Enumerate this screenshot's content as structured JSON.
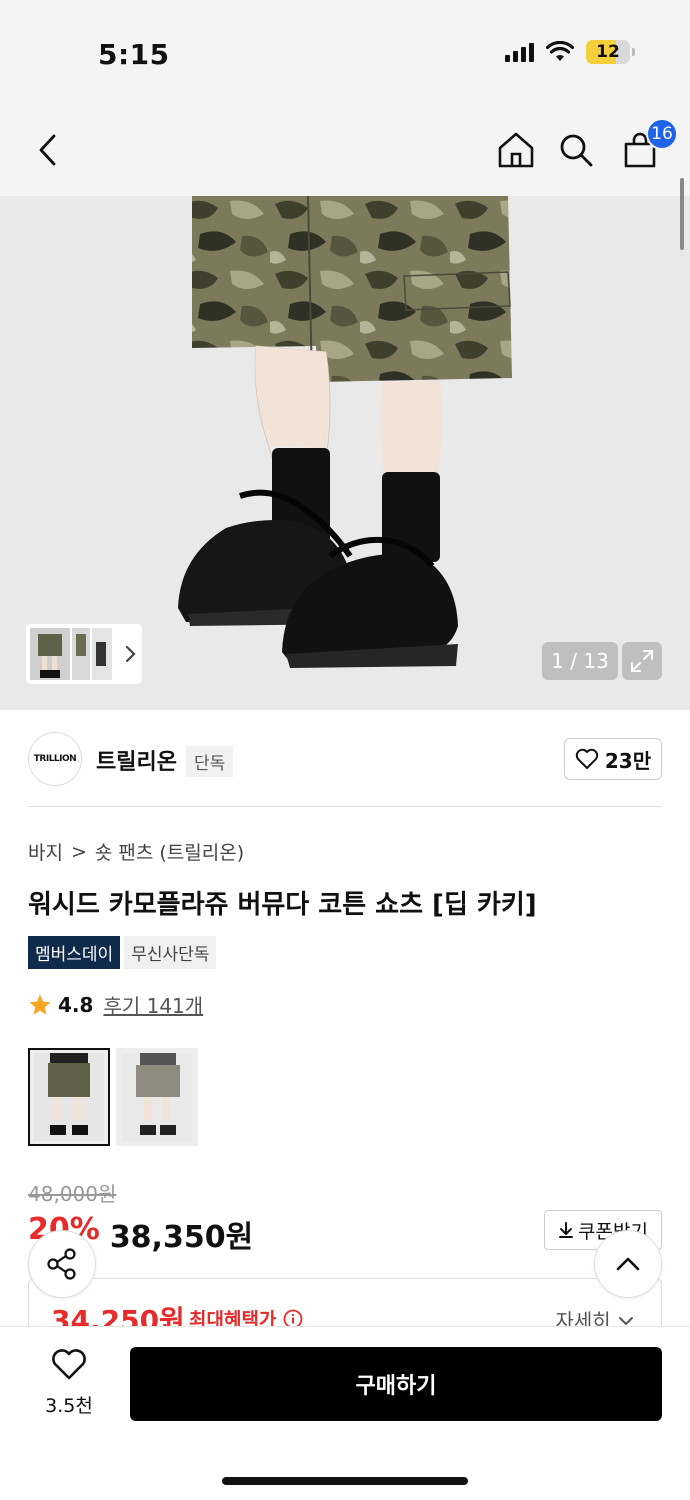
{
  "status_bar": {
    "time": "5:15",
    "battery": "12"
  },
  "nav": {
    "cart_count": "16"
  },
  "gallery": {
    "counter": "1 / 13"
  },
  "brand": {
    "logo_text": "TRILLION",
    "name": "트릴리온",
    "tag": "단독",
    "likes": "23만"
  },
  "breadcrumb": {
    "category": "바지",
    "separator": ">",
    "subcategory": "숏 팬츠 (트릴리온)"
  },
  "product": {
    "title": "워시드 카모플라쥬 버뮤다 코튼 쇼츠 [딥 카키]",
    "badges": [
      "멤버스데이",
      "무신사단독"
    ],
    "rating": "4.8",
    "reviews_label": "후기 141개"
  },
  "price": {
    "original": "48,000원",
    "discount": "20%",
    "sale": "38,350원",
    "coupon_label": "쿠폰받기",
    "max_benefit_price": "34,250원",
    "max_benefit_label": "최대혜택가",
    "details_label": "자세히"
  },
  "bottom_bar": {
    "wish_count": "3.5천",
    "buy_label": "구매하기"
  },
  "colors": {
    "accent_red": "#e62b2b",
    "badge_navy": "#0f2a4a",
    "cart_badge_blue": "#1e63e8"
  }
}
